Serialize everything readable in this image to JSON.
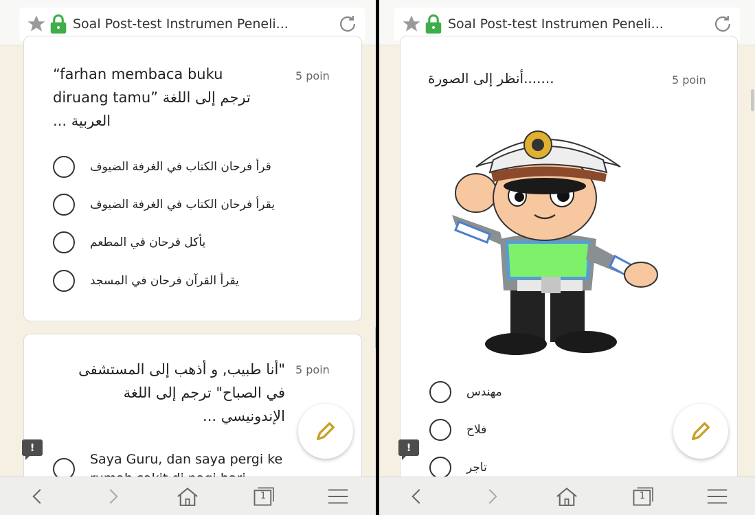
{
  "left": {
    "url_title": "Soal Post-test Instrumen Peneli...",
    "q1": {
      "title_lines": [
        "“farhan membaca buku",
        "diruang tamu” ترجم إلى اللغة",
        "العربية ..."
      ],
      "points": "5 poin",
      "options": [
        "قرأ فرحان الكتاب في الغرفة الضيوف",
        "يقرأ فرحان الكتاب في الغرفة الضيوف",
        "يأكل فرحان في المطعم",
        "يقرأ القرآن فرحان في المسجد"
      ]
    },
    "q2": {
      "title_lines": [
        "\"أنا طبيب, و أذهب إلى المستشفى",
        "في الصباح\" ترجم إلى اللغة",
        "الإندونيسي ..."
      ],
      "points": "5 poin",
      "options": [
        "Saya Guru, dan saya pergi ke",
        "rumah sakit di pagi hari"
      ]
    }
  },
  "right": {
    "url_title": "Soal Post-test Instrumen Peneli...",
    "q": {
      "title": ".......أنظر إلى الصورة",
      "points": "5 poin",
      "options": [
        "مهندس",
        "فلاح",
        "تاجر"
      ]
    }
  },
  "nav": {
    "tab_count": "1"
  },
  "colors": {
    "background": "#f5f0e1",
    "card": "#ffffff",
    "lock_green": "#3fae49",
    "pencil": "#c9a12a"
  },
  "icons": [
    "star-icon",
    "lock-icon",
    "reload-icon",
    "back-icon",
    "forward-icon",
    "home-icon",
    "tabs-icon",
    "menu-icon",
    "pencil-icon",
    "report-icon"
  ]
}
